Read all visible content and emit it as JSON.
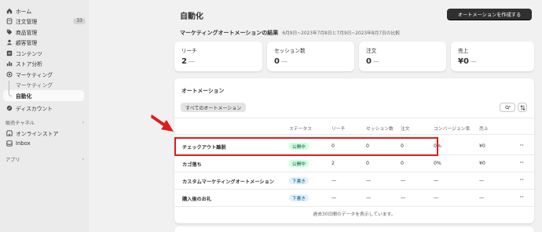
{
  "sidebar": {
    "items": [
      {
        "label": "ホーム",
        "icon": "home-icon"
      },
      {
        "label": "注文管理",
        "icon": "order-icon",
        "count": "33"
      },
      {
        "label": "商品管理",
        "icon": "tag-icon"
      },
      {
        "label": "顧客管理",
        "icon": "person-icon"
      },
      {
        "label": "コンテンツ",
        "icon": "content-icon"
      },
      {
        "label": "ストア分析",
        "icon": "chart-icon"
      },
      {
        "label": "マーケティング",
        "icon": "target-icon"
      },
      {
        "label": "マーケティング",
        "icon": ""
      },
      {
        "label": "自動化",
        "icon": ""
      },
      {
        "label": "ディスカウント",
        "icon": "discount-icon"
      }
    ],
    "channels_label": "販売チャネル",
    "channels": [
      {
        "label": "オンラインストア",
        "icon": "store-icon"
      },
      {
        "label": "Inbox",
        "icon": "inbox-icon"
      }
    ],
    "apps_label": "アプリ"
  },
  "page": {
    "title": "自動化",
    "create_button": "オートメーションを作成する",
    "report_title": "マーケティングオートメーションの結果",
    "report_range": "6月9日~2023年7月8日と7月9日~2023年8月7日の比較"
  },
  "metrics": [
    {
      "label": "リーチ",
      "value": "2",
      "dash": "—"
    },
    {
      "label": "セッション数",
      "value": "0",
      "dash": "—"
    },
    {
      "label": "注文",
      "value": "0",
      "dash": "—"
    },
    {
      "label": "売上",
      "value": "¥0",
      "dash": "—"
    }
  ],
  "automations": {
    "title": "オートメーション",
    "filter_tab": "すべてのオートメーション",
    "columns": [
      "ステータス",
      "リーチ",
      "セッション数",
      "注文",
      "コンバージョン率",
      "売上"
    ],
    "rows": [
      {
        "name": "チェックアウト離脱",
        "status": "公開中",
        "status_type": "published",
        "reach": "0",
        "sessions": "0",
        "orders": "0",
        "conversion": "0%",
        "sales": "¥0"
      },
      {
        "name": "カゴ落ち",
        "status": "公開中",
        "status_type": "published",
        "reach": "2",
        "sessions": "0",
        "orders": "0",
        "conversion": "0%",
        "sales": "¥0"
      },
      {
        "name": "カスタムマーケティングオートメーション",
        "status": "下書き",
        "status_type": "draft",
        "reach": "—",
        "sessions": "—",
        "orders": "—",
        "conversion": "—",
        "sales": "—"
      },
      {
        "name": "購入後のお礼",
        "status": "下書き",
        "status_type": "draft",
        "reach": "—",
        "sessions": "—",
        "orders": "—",
        "conversion": "—",
        "sales": "—"
      }
    ],
    "footer_note": "過去30日間のデータを表示しています。",
    "more_icon": "···"
  },
  "colors": {
    "highlight": "#e01b1b",
    "published_bg": "#cdfee1",
    "draft_bg": "#e0f0ff"
  }
}
